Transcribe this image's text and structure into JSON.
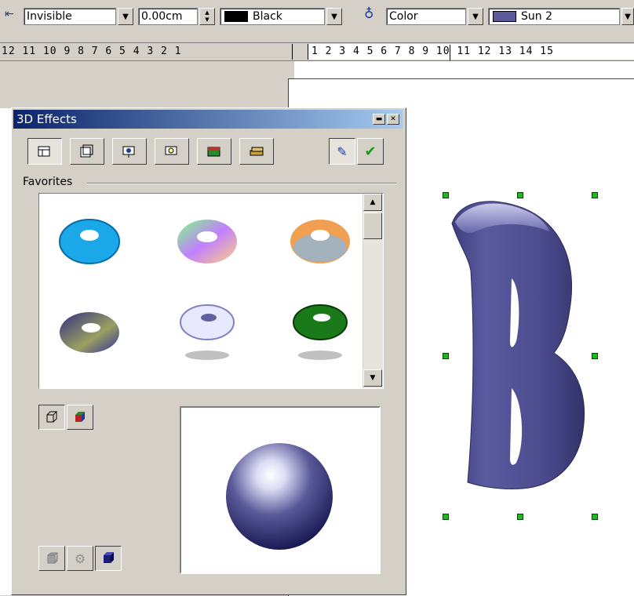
{
  "toolbar": {
    "line_style": "Invisible",
    "line_width": "0.00cm",
    "line_color_label": "Black",
    "line_color_hex": "#000000",
    "area_style": "Color",
    "area_color_label": "Sun 2",
    "area_color_hex": "#5c5a9a",
    "icons": [
      "line-ends-icon",
      "area-fill-icon"
    ]
  },
  "ruler": {
    "left_numbers": "12 11 10  9  8  7  6  5  4  3  2  1",
    "right_numbers": "1  2  3  4  5  6  7  8  9  10 11 12 13 14 15"
  },
  "dialog": {
    "title": "3D Effects",
    "favorites_label": "Favorites",
    "tools": [
      "geometry-icon",
      "shading-icon",
      "illumination-icon",
      "textures-icon",
      "material-icon"
    ],
    "favorites": [
      {
        "name": "torus-cyan",
        "color": "#1aa8e8"
      },
      {
        "name": "torus-rainbow",
        "color": "#c080ff"
      },
      {
        "name": "torus-orange",
        "color": "#f0a050"
      },
      {
        "name": "torus-blue-green",
        "color": "#4a58a8"
      },
      {
        "name": "torus-white",
        "color": "#e8e8ff"
      },
      {
        "name": "torus-green",
        "color": "#1a7a1a"
      }
    ],
    "preview_sphere_color": "#3a3a7a"
  },
  "canvas": {
    "object_text": "B",
    "object_color": "#4a4a8c"
  }
}
